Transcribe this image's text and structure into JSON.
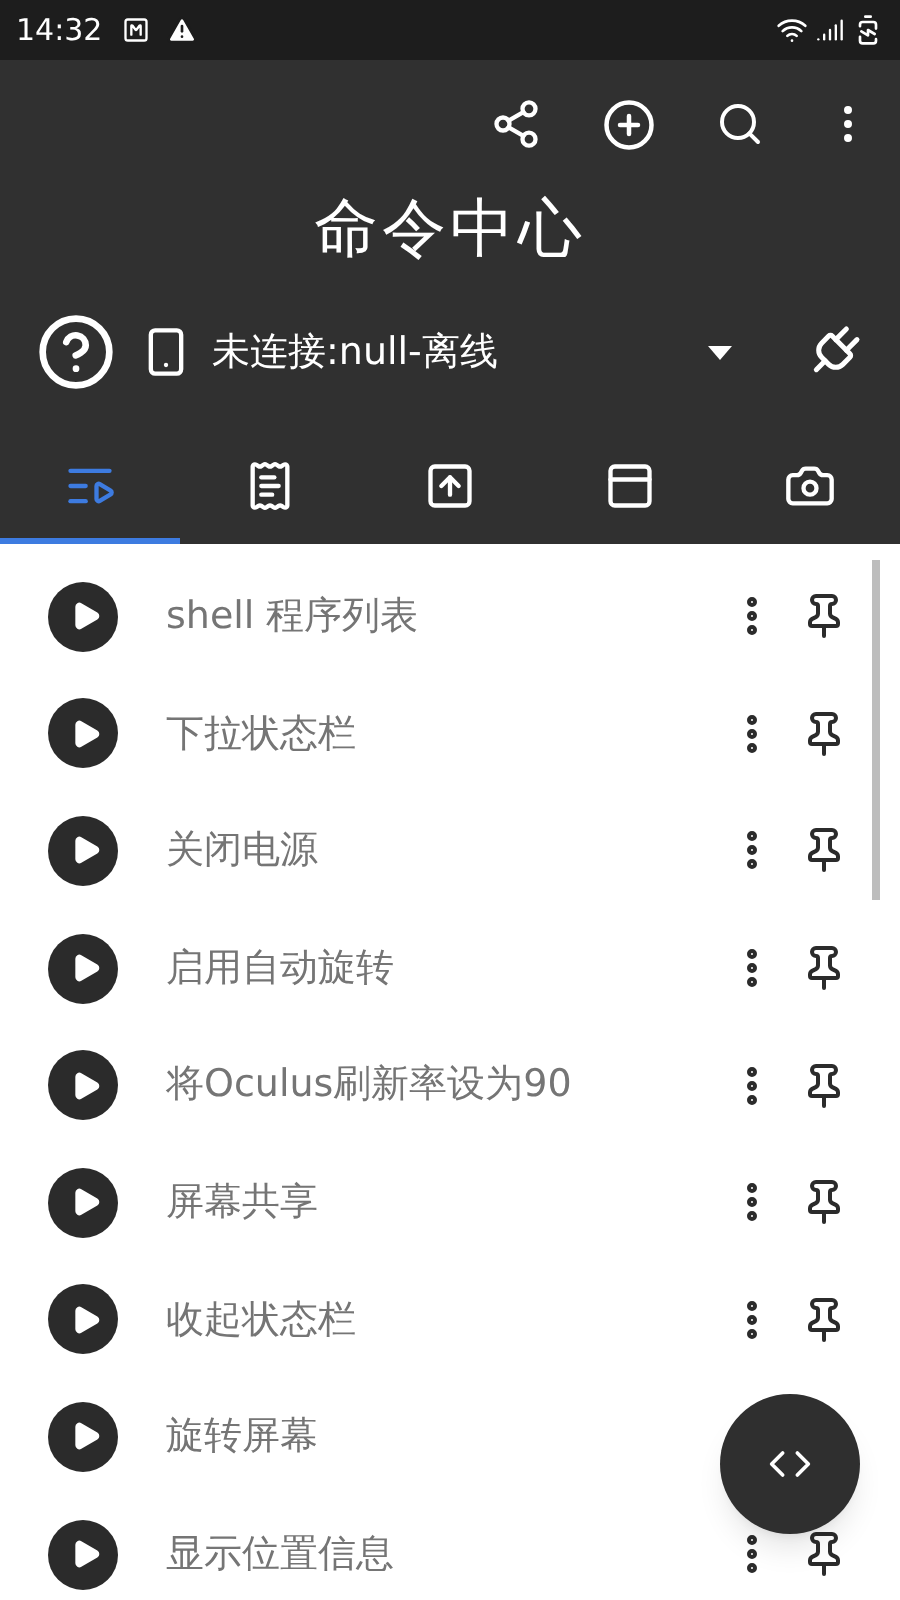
{
  "status_bar": {
    "time": "14:32"
  },
  "title": "命令中心",
  "connection": {
    "label": "未连接:null-离线"
  },
  "tabs": [
    {
      "kind": "list",
      "selected": true
    },
    {
      "kind": "notes",
      "selected": false
    },
    {
      "kind": "upload",
      "selected": false
    },
    {
      "kind": "card",
      "selected": false
    },
    {
      "kind": "camera",
      "selected": false
    }
  ],
  "commands": [
    {
      "name": "shell 程序列表",
      "kind": "full"
    },
    {
      "name": "下拉状态栏",
      "kind": "full"
    },
    {
      "name": "关闭电源",
      "kind": "full"
    },
    {
      "name": "启用自动旋转",
      "kind": "full"
    },
    {
      "name": "将Oculus刷新率设为90",
      "kind": "full"
    },
    {
      "name": "屏幕共享",
      "kind": "full"
    },
    {
      "name": "收起状态栏",
      "kind": "full"
    },
    {
      "name": "旋转屏幕",
      "kind": "bare"
    },
    {
      "name": "显示位置信息",
      "kind": "full"
    }
  ]
}
